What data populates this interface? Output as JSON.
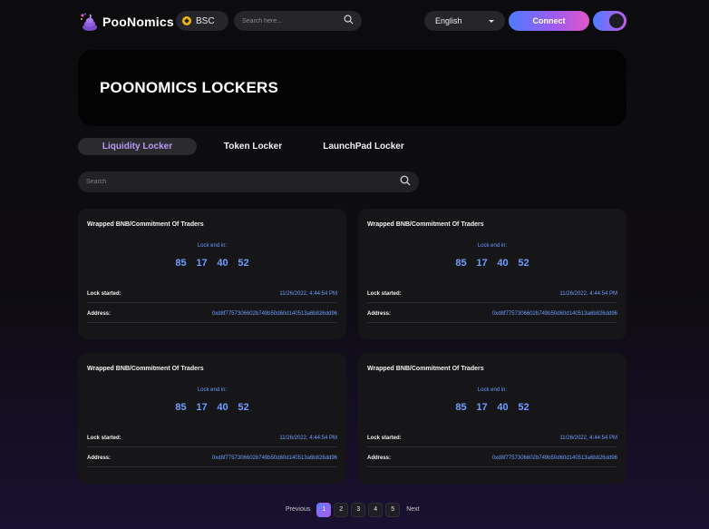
{
  "header": {
    "logo_text": "PooNomics",
    "network": "BSC",
    "search_placeholder": "Search here...",
    "language": "English",
    "connect_label": "Connect"
  },
  "banner": {
    "title": "POONOMICS LOCKERS"
  },
  "tabs": [
    {
      "label": "Liquidity Locker",
      "active": true
    },
    {
      "label": "Token Locker",
      "active": false
    },
    {
      "label": "LaunchPad Locker",
      "active": false
    }
  ],
  "search": {
    "placeholder": "Search"
  },
  "cards": [
    {
      "title": "Wrapped BNB/Commitment Of Traders",
      "lock_label": "Lock end in:",
      "countdown": [
        "85",
        "17",
        "40",
        "52"
      ],
      "lock_started_label": "Lock started:",
      "lock_started_value": "11/26/2022, 4:44:54 PM",
      "address_label": "Address:",
      "address_value": "0xd8f7757306602b749b50d60d140513a6b826dd96"
    },
    {
      "title": "Wrapped BNB/Commitment Of Traders",
      "lock_label": "Lock end in:",
      "countdown": [
        "85",
        "17",
        "40",
        "52"
      ],
      "lock_started_label": "Lock started:",
      "lock_started_value": "11/26/2022, 4:44:54 PM",
      "address_label": "Address:",
      "address_value": "0xd8f7757306602b749b50d60d140513a6b826dd96"
    },
    {
      "title": "Wrapped BNB/Commitment Of Traders",
      "lock_label": "Lock end in:",
      "countdown": [
        "85",
        "17",
        "40",
        "52"
      ],
      "lock_started_label": "Lock started:",
      "lock_started_value": "11/26/2022, 4:44:54 PM",
      "address_label": "Address:",
      "address_value": "0xd8f7757306602b749b50d60d140513a6b826dd96"
    },
    {
      "title": "Wrapped BNB/Commitment Of Traders",
      "lock_label": "Lock end in:",
      "countdown": [
        "85",
        "17",
        "40",
        "52"
      ],
      "lock_started_label": "Lock started:",
      "lock_started_value": "11/26/2022, 4:44:54 PM",
      "address_label": "Address:",
      "address_value": "0xd8f7757306602b749b50d60d140513a6b826dd96"
    }
  ],
  "pagination": {
    "previous": "Previous",
    "next": "Next",
    "pages": [
      "1",
      "2",
      "3",
      "4",
      "5"
    ],
    "current": "1"
  },
  "colors": {
    "accent_blue": "#6f9cff",
    "accent_purple": "#b69cf5",
    "connect_gradient": [
      "#4d7cff",
      "#9b5cf0",
      "#e056c8"
    ],
    "bsc_yellow": "#f0b90b"
  },
  "icons": [
    "poonomics-logo-icon",
    "bsc-icon",
    "search-icon",
    "chevron-down-icon",
    "theme-toggle-icon"
  ]
}
